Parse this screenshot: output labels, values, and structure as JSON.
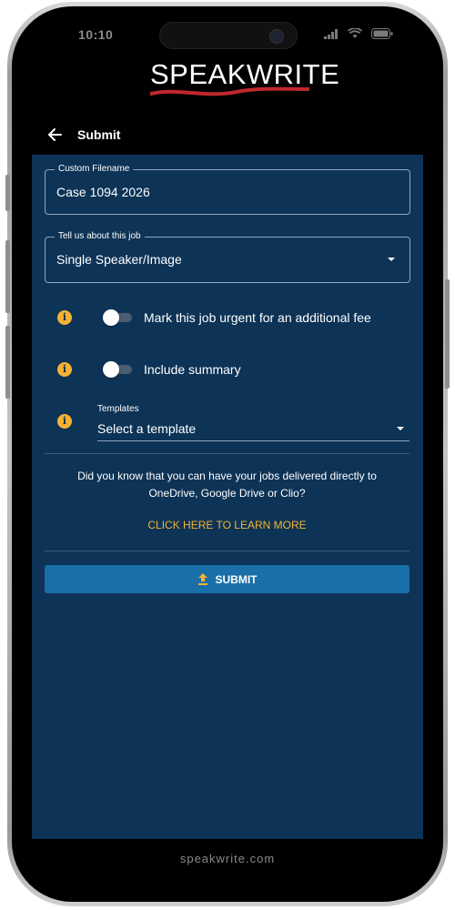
{
  "status_bar": {
    "time": "10:10"
  },
  "brand": {
    "logo_part1": "SPEAK",
    "logo_part2": "WRITE",
    "website": "speakwrite.com"
  },
  "header": {
    "title": "Submit"
  },
  "form": {
    "custom_filename": {
      "label": "Custom Filename",
      "value": "Case 1094 2026"
    },
    "job_type": {
      "label": "Tell us about this job",
      "value": "Single Speaker/Image"
    },
    "urgent_toggle": {
      "label": "Mark this job urgent for an additional fee",
      "on": false
    },
    "summary_toggle": {
      "label": "Include summary",
      "on": false
    },
    "templates": {
      "label": "Templates",
      "value": "Select a template"
    }
  },
  "promo": {
    "line1": "Did you know that you can have your jobs delivered directly to",
    "line2": "OneDrive, Google Drive or Clio?",
    "link": "CLICK HERE TO LEARN MORE"
  },
  "submit": {
    "label": "SUBMIT"
  },
  "colors": {
    "background": "#0d3356",
    "accent": "#f4b234",
    "button": "#1b6fa8",
    "logo_swoosh": "#c0272d"
  }
}
